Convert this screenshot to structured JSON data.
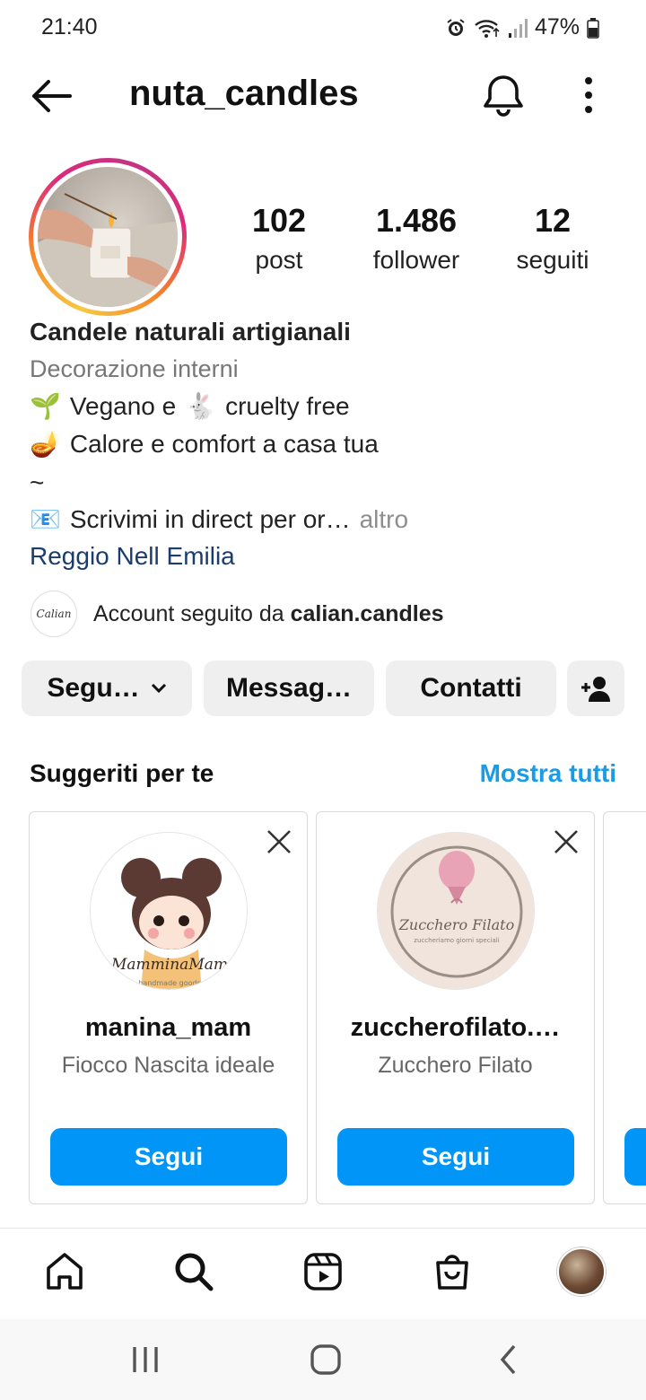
{
  "status_bar": {
    "time": "21:40",
    "battery": "47%",
    "icons": [
      "alarm-icon",
      "wifi-icon",
      "signal-icon",
      "battery-icon"
    ]
  },
  "header": {
    "username": "nuta_candles",
    "icons": [
      "back-arrow-icon",
      "bell-icon",
      "more-vertical-icon"
    ]
  },
  "stats": [
    {
      "value": "102",
      "label": "post"
    },
    {
      "value": "1.486",
      "label": "follower"
    },
    {
      "value": "12",
      "label": "seguiti"
    }
  ],
  "bio": {
    "name": "Candele naturali artigianali",
    "category": "Decorazione interni",
    "line1": {
      "emoji1": "🌱",
      "text1": "Vegano e",
      "emoji2": "🐇",
      "text2": "cruelty free"
    },
    "line2": {
      "emoji": "🪔",
      "text": "Calore e comfort a casa tua"
    },
    "tilde": "~",
    "line3": {
      "emoji": "📧",
      "text": "Scrivimi in direct per or…",
      "more": "altro"
    },
    "location": "Reggio Nell Emilia"
  },
  "followed_by": {
    "avatar_text": "Calian",
    "prefix": "Account seguito da",
    "account": "calian.candles"
  },
  "actions": {
    "follow": "Segu…",
    "message": "Messag…",
    "contacts": "Contatti"
  },
  "suggestions": {
    "title": "Suggeriti per te",
    "show_all": "Mostra tutti",
    "cards": [
      {
        "name": "manina_mam",
        "subtitle": "Fiocco Nascita ideale",
        "button": "Segui",
        "logo_text": "MamminaMam",
        "logo_sub": "handmade goods"
      },
      {
        "name": "zuccherofilato.…",
        "subtitle": "Zucchero Filato",
        "button": "Segui",
        "logo_text": "Zucchero Filato",
        "logo_sub": "zuccheriamo giorni speciali"
      }
    ]
  },
  "bottom_nav": [
    "home-icon",
    "search-icon",
    "reels-icon",
    "shop-icon",
    "profile-avatar"
  ],
  "colors": {
    "accent_blue": "#0095f6",
    "link_blue": "#1a9be6",
    "location_blue": "#1a3d6d",
    "button_gray": "#efefef"
  }
}
